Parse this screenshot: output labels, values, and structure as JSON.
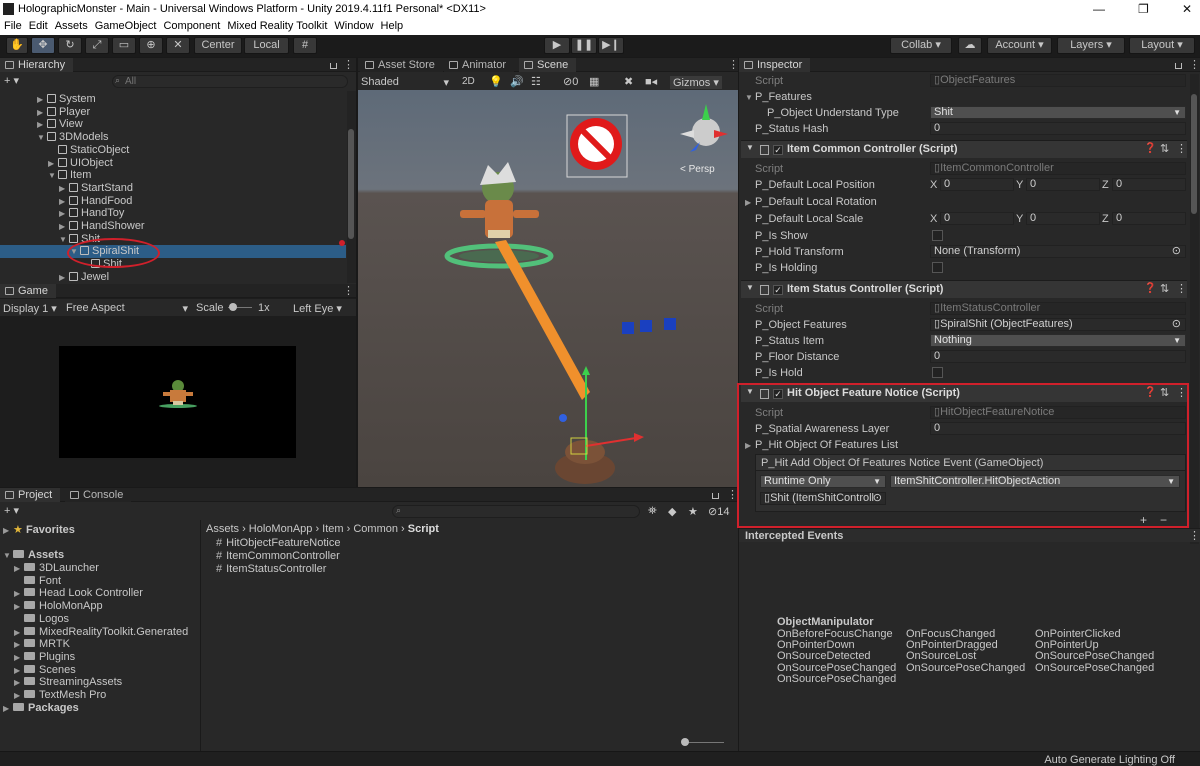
{
  "window": {
    "title": "HolographicMonster - Main - Universal Windows Platform - Unity 2019.4.11f1 Personal* <DX11>",
    "min": "—",
    "max": "❐",
    "close": "✕"
  },
  "menu": [
    "File",
    "Edit",
    "Assets",
    "GameObject",
    "Component",
    "Mixed Reality Toolkit",
    "Window",
    "Help"
  ],
  "toolbar": {
    "center": "Center",
    "local": "Local",
    "collab": "Collab ▾",
    "account": "Account",
    "layers": "Layers",
    "layout": "Layout"
  },
  "hierarchy": {
    "tab": "Hierarchy",
    "search_placeholder": "All",
    "add": "+ ▾",
    "items": [
      {
        "label": "System",
        "depth": 1,
        "open": false
      },
      {
        "label": "Player",
        "depth": 1,
        "open": false
      },
      {
        "label": "View",
        "depth": 1,
        "open": false
      },
      {
        "label": "3DModels",
        "depth": 1,
        "open": true
      },
      {
        "label": "StaticObject",
        "depth": 2,
        "open": null
      },
      {
        "label": "UIObject",
        "depth": 2,
        "open": false
      },
      {
        "label": "Item",
        "depth": 2,
        "open": true
      },
      {
        "label": "StartStand",
        "depth": 3,
        "open": false
      },
      {
        "label": "HandFood",
        "depth": 3,
        "open": false
      },
      {
        "label": "HandToy",
        "depth": 3,
        "open": false
      },
      {
        "label": "HandShower",
        "depth": 3,
        "open": false
      },
      {
        "label": "Shit",
        "depth": 3,
        "open": true
      },
      {
        "label": "SpiralShit",
        "depth": 4,
        "open": true
      },
      {
        "label": "Shit",
        "depth": 5,
        "open": null
      },
      {
        "label": "Jewel",
        "depth": 3,
        "open": false
      }
    ]
  },
  "game": {
    "tab": "Game",
    "display": "Display 1",
    "aspect": "Free Aspect",
    "scale_label": "Scale",
    "scale_value": "1x",
    "eye": "Left Eye"
  },
  "scene_tabs": {
    "asset_store": "Asset Store",
    "animator": "Animator",
    "scene": "Scene",
    "shaded": "Shaded",
    "mode_2d": "2D",
    "gizmos": "Gizmos",
    "persp": "< Persp",
    "zero": "0"
  },
  "project": {
    "tab_project": "Project",
    "tab_console": "Console",
    "add": "+ ▾",
    "count": "14",
    "favorites": "Favorites",
    "assets": "Assets",
    "folders": [
      "3DLauncher",
      "Font",
      "Head Look Controller",
      "HoloMonApp",
      "Logos",
      "MixedRealityToolkit.Generated",
      "MRTK",
      "Plugins",
      "Scenes",
      "StreamingAssets",
      "TextMesh Pro"
    ],
    "packages": "Packages",
    "breadcrumb": [
      "Assets",
      "HoloMonApp",
      "Item",
      "Common",
      "Script"
    ],
    "files": [
      "HitObjectFeatureNotice",
      "ItemCommonController",
      "ItemStatusController"
    ]
  },
  "inspector": {
    "tab": "Inspector",
    "top": {
      "script_label": "Script",
      "script_value": "ObjectFeatures",
      "features": "P_Features",
      "understand_label": "P_Object Understand Type",
      "understand_value": "Shit",
      "status_hash_label": "P_Status Hash",
      "status_hash_value": "0"
    },
    "c1": {
      "title": "Item Common Controller (Script)",
      "script_label": "Script",
      "script_value": "ItemCommonController",
      "pos_label": "P_Default Local Position",
      "rot_label": "P_Default Local Rotation",
      "scale_label": "P_Default Local Scale",
      "x": "X",
      "y": "Y",
      "z": "Z",
      "zero": "0",
      "show_label": "P_Is Show",
      "hold_tf_label": "P_Hold Transform",
      "hold_tf_value": "None (Transform)",
      "holding_label": "P_Is Holding"
    },
    "c2": {
      "title": "Item Status Controller (Script)",
      "script_label": "Script",
      "script_value": "ItemStatusController",
      "features_label": "P_Object Features",
      "features_value": "SpiralShit (ObjectFeatures)",
      "status_item_label": "P_Status Item",
      "status_item_value": "Nothing",
      "floor_label": "P_Floor Distance",
      "floor_value": "0",
      "is_hold_label": "P_Is Hold"
    },
    "c3": {
      "title": "Hit Object Feature Notice (Script)",
      "script_label": "Script",
      "script_value": "HitObjectFeatureNotice",
      "layer_label": "P_Spatial Awareness Layer",
      "layer_value": "0",
      "list_label": "P_Hit Object Of Features List",
      "event_label": "P_Hit Add Object Of Features Notice Event (GameObject)",
      "runtime": "Runtime Only",
      "action": "ItemShitController.HitObjectAction",
      "target": "Shit (ItemShitControll",
      "plus": "+",
      "minus": "−"
    },
    "intercepted": "Intercepted Events",
    "manip_title": "ObjectManipulator",
    "events": [
      [
        "OnBeforeFocusChange",
        "OnFocusChanged",
        "OnPointerClicked"
      ],
      [
        "OnPointerDown",
        "OnPointerDragged",
        "OnPointerUp"
      ],
      [
        "OnSourceDetected",
        "OnSourceLost",
        "OnSourcePoseChanged"
      ],
      [
        "OnSourcePoseChanged",
        "OnSourcePoseChanged",
        "OnSourcePoseChanged"
      ],
      [
        "OnSourcePoseChanged",
        "",
        ""
      ]
    ]
  },
  "status": {
    "lighting": "Auto Generate Lighting Off"
  },
  "colors": {
    "accent_red": "#d0202b",
    "selection": "#2c5d87",
    "panel": "#282828",
    "orange": "#f0902c"
  }
}
